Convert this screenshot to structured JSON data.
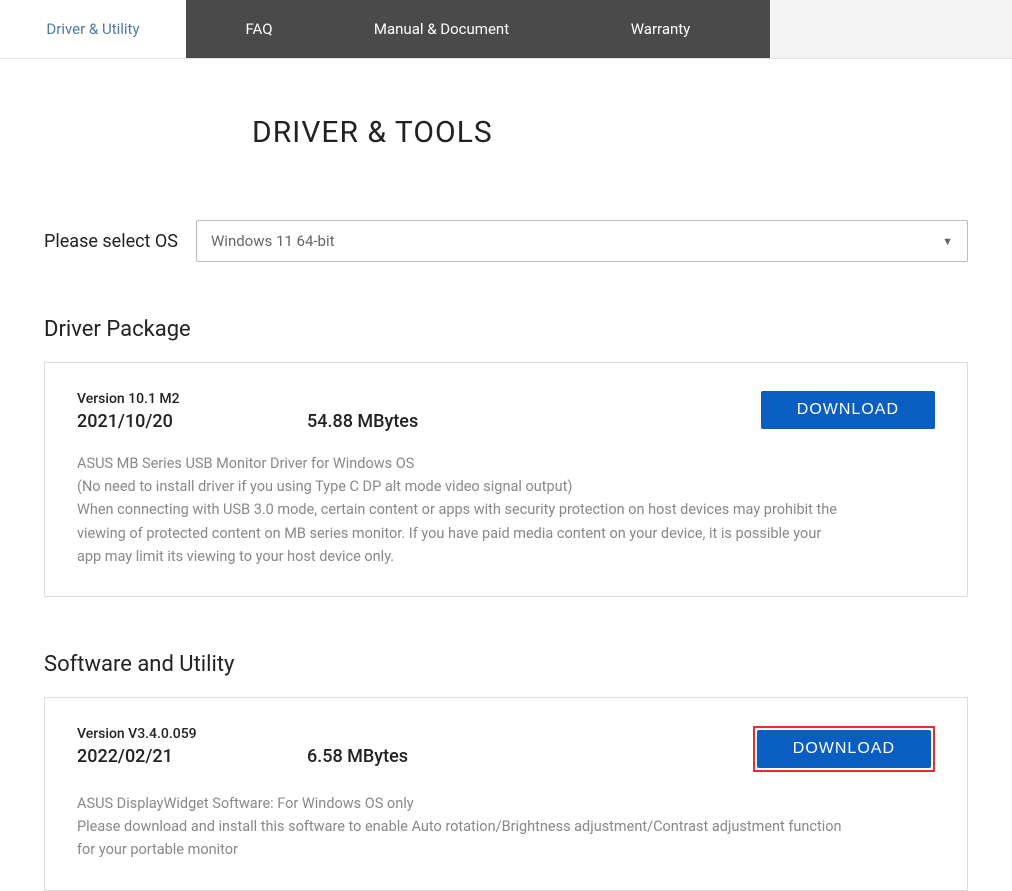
{
  "tabs": {
    "items": [
      {
        "label": "Driver & Utility"
      },
      {
        "label": "FAQ"
      },
      {
        "label": "Manual & Document"
      },
      {
        "label": "Warranty"
      }
    ]
  },
  "page_title": "DRIVER & TOOLS",
  "os_selector": {
    "label": "Please select OS",
    "selected": "Windows 11 64-bit"
  },
  "sections": {
    "driver_package": {
      "title": "Driver Package",
      "item": {
        "version_label": "Version 10.1 M2",
        "date": "2021/10/20",
        "size": "54.88 MBytes",
        "download_label": "DOWNLOAD",
        "description_line1": "ASUS MB Series USB Monitor Driver for Windows OS",
        "description_line2": "(No need to install driver if you using Type C DP alt mode video signal output)",
        "description_line3": "When connecting with USB 3.0 mode, certain content or apps with security protection on host devices may prohibit the viewing of protected content on MB series monitor. If you have paid media content on your device, it is possible your app may limit its viewing to your host device only."
      }
    },
    "software_utility": {
      "title": "Software and Utility",
      "item": {
        "version_label": "Version V3.4.0.059",
        "date": "2022/02/21",
        "size": "6.58 MBytes",
        "download_label": "DOWNLOAD",
        "description_line1": "ASUS DisplayWidget Software: For Windows OS only",
        "description_line2": "Please download and install this software to enable Auto rotation/Brightness adjustment/Contrast adjustment function for your portable monitor"
      }
    }
  }
}
